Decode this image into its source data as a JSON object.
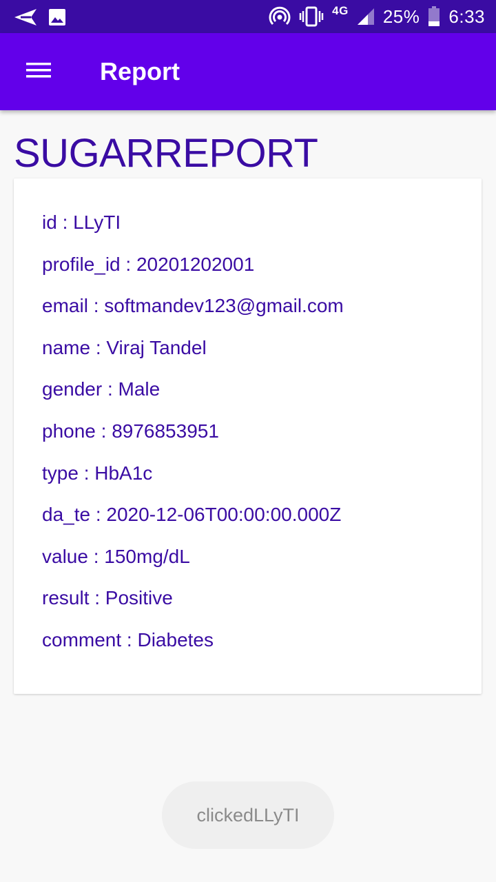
{
  "status_bar": {
    "left_icons": [
      "send-icon",
      "image-icon"
    ],
    "right_icons": [
      "hotspot-icon",
      "vibrate-icon",
      "signal-icon",
      "battery-icon"
    ],
    "network": "4G",
    "battery_percent": "25%",
    "battery_level": 0.25,
    "time": "6:33"
  },
  "app_bar": {
    "menu_icon": "hamburger-menu-icon",
    "title": "Report"
  },
  "page_heading": "SUGARREPORT",
  "report": {
    "id": "id : LLyTI",
    "profile_id": "profile_id : 20201202001",
    "email": "email : softmandev123@gmail.com",
    "name": "name : Viraj Tandel",
    "gender": "gender : Male",
    "phone": "phone : 8976853951",
    "type": "type : HbA1c",
    "date": "da_te : 2020-12-06T00:00:00.000Z",
    "value": "value : 150mg/dL",
    "result": "result : Positive",
    "comment": "comment : Diabetes"
  },
  "toast": {
    "message": "clickedLLyTI"
  },
  "colors": {
    "status_bar_bg": "#3a0ca3",
    "app_bar_bg": "#6200ea",
    "text_primary": "#3a0ca3",
    "page_bg": "#f8f8f8",
    "card_bg": "#ffffff",
    "toast_bg": "#efefef",
    "toast_text": "#8a8a8a"
  }
}
